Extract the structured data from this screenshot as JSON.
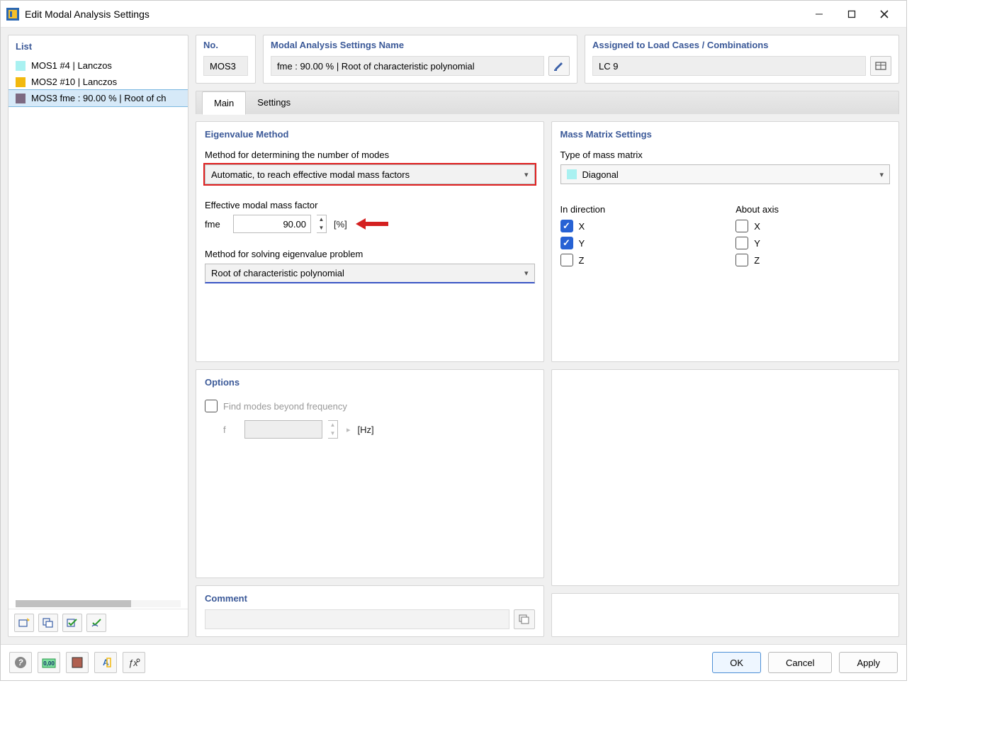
{
  "window": {
    "title": "Edit Modal Analysis Settings"
  },
  "list": {
    "title": "List",
    "items": [
      {
        "color": "#a9f1f1",
        "label": "MOS1 #4 | Lanczos"
      },
      {
        "color": "#f2b90f",
        "label": "MOS2 #10 | Lanczos"
      },
      {
        "color": "#7d6a82",
        "label": "MOS3 fme : 90.00 % | Root of ch",
        "selected": true
      }
    ]
  },
  "top": {
    "no_label": "No.",
    "no_value": "MOS3",
    "name_label": "Modal Analysis Settings Name",
    "name_value": "fme : 90.00 % | Root of characteristic polynomial",
    "assigned_label": "Assigned to Load Cases / Combinations",
    "assigned_value": "LC 9"
  },
  "tabs": {
    "main": "Main",
    "settings": "Settings"
  },
  "eigen": {
    "title": "Eigenvalue Method",
    "modes_label": "Method for determining the number of modes",
    "modes_value": "Automatic, to reach effective modal mass factors",
    "factor_label": "Effective modal mass factor",
    "factor_symbol": "fme",
    "factor_value": "90.00",
    "factor_unit": "[%]",
    "solve_label": "Method for solving eigenvalue problem",
    "solve_value": "Root of characteristic polynomial"
  },
  "options": {
    "title": "Options",
    "find_modes": "Find modes beyond frequency",
    "f_symbol": "f",
    "f_unit": "[Hz]"
  },
  "mass": {
    "title": "Mass Matrix Settings",
    "type_label": "Type of mass matrix",
    "type_value": "Diagonal",
    "direction_head": "In direction",
    "axis_head": "About axis",
    "dir": {
      "x": true,
      "y": true,
      "z": false
    },
    "axis": {
      "x": false,
      "y": false,
      "z": false
    },
    "labels": {
      "x": "X",
      "y": "Y",
      "z": "Z"
    }
  },
  "comment": {
    "title": "Comment",
    "value": ""
  },
  "buttons": {
    "ok": "OK",
    "cancel": "Cancel",
    "apply": "Apply"
  }
}
